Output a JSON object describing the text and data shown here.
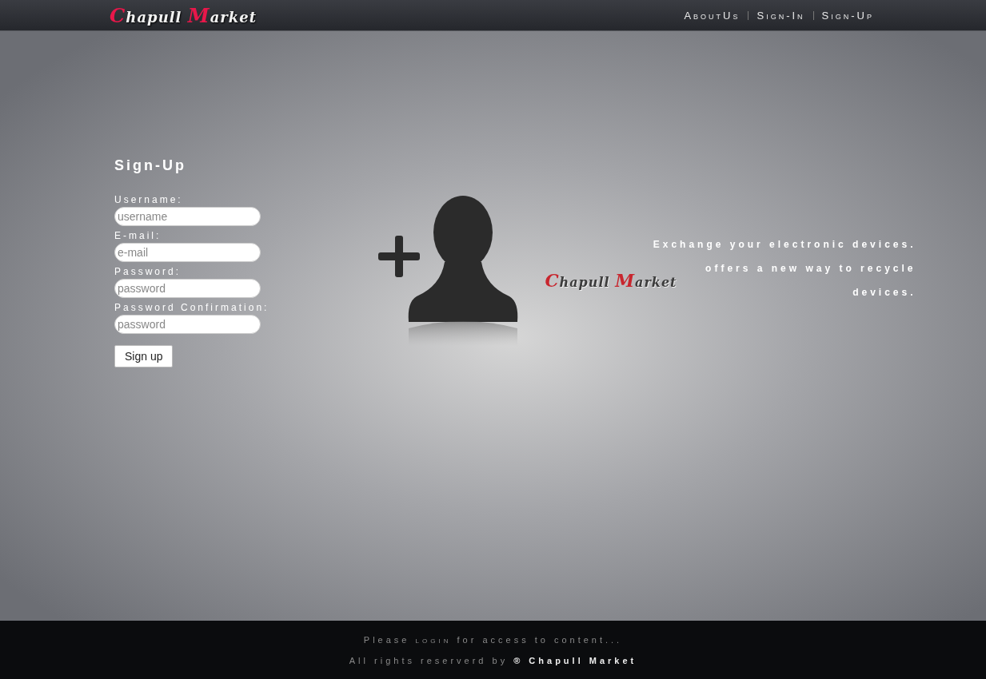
{
  "header": {
    "logo": [
      {
        "initial": "C",
        "rest": "hapull"
      },
      {
        "initial": "M",
        "rest": "arket"
      }
    ],
    "nav": [
      {
        "label": "AboutUs"
      },
      {
        "label": "Sign-In"
      },
      {
        "label": "Sign-Up"
      }
    ]
  },
  "form": {
    "title": "Sign-Up",
    "fields": [
      {
        "label": "Username:",
        "placeholder": "username"
      },
      {
        "label": "E-mail:",
        "placeholder": "e-mail"
      },
      {
        "label": "Password:",
        "placeholder": "password"
      },
      {
        "label": "Password Confirmation:",
        "placeholder": "password"
      }
    ],
    "submit": "Sign up"
  },
  "promo": {
    "headline": "Exchange your electronic devices.",
    "logo": [
      {
        "initial": "C",
        "rest": "hapull"
      },
      {
        "initial": "M",
        "rest": "arket"
      }
    ],
    "text": "offers a new way to recycle devices."
  },
  "footer": {
    "before": "Please",
    "link": "login",
    "after": "for access to content...",
    "rights": "All rights reserverd by",
    "brand": "® Chapull Market"
  }
}
